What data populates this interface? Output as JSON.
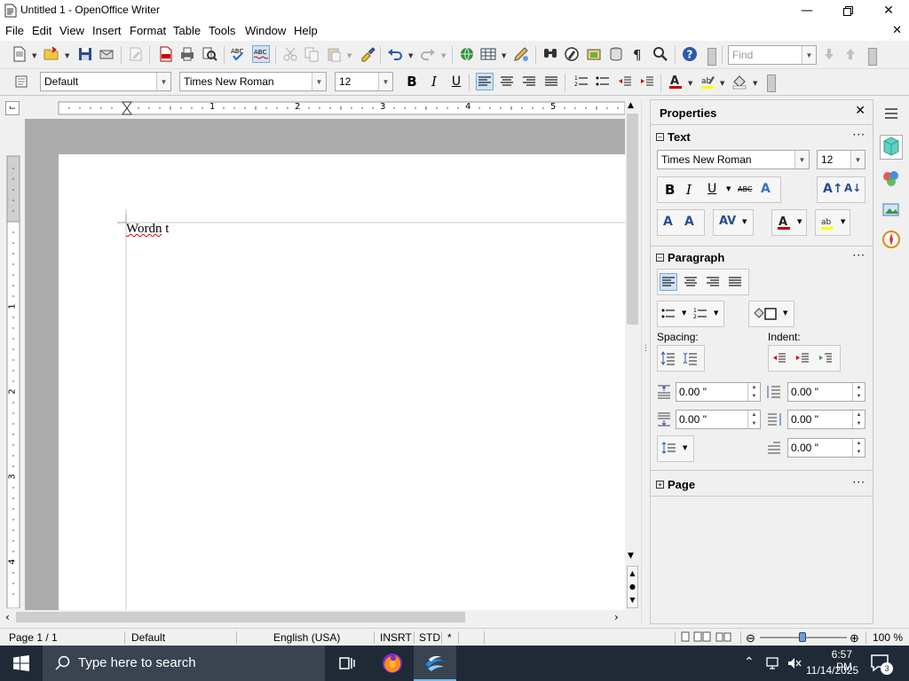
{
  "window": {
    "title": "Untitled 1 - OpenOffice Writer"
  },
  "menu": {
    "items": [
      {
        "label": "File",
        "mnemonic": "F"
      },
      {
        "label": "Edit",
        "mnemonic": "E"
      },
      {
        "label": "View",
        "mnemonic": "V"
      },
      {
        "label": "Insert",
        "mnemonic": "I"
      },
      {
        "label": "Format",
        "mnemonic": "o"
      },
      {
        "label": "Table",
        "mnemonic": "a"
      },
      {
        "label": "Tools",
        "mnemonic": "T"
      },
      {
        "label": "Window",
        "mnemonic": "W"
      },
      {
        "label": "Help",
        "mnemonic": "H"
      }
    ]
  },
  "toolbar": {
    "find_placeholder": "Find"
  },
  "format_toolbar": {
    "paragraph_style": "Default",
    "font_name": "Times New Roman",
    "font_size": "12"
  },
  "ruler": {
    "h_numbers": [
      "1",
      "2",
      "3",
      "4",
      "5"
    ],
    "v_numbers": [
      "1",
      "2",
      "3",
      "4"
    ]
  },
  "document": {
    "text_misspelled": "Wordn",
    "text_rest": " t"
  },
  "sidebar": {
    "title": "Properties",
    "text_section": {
      "header": "Text",
      "font_name": "Times New Roman",
      "font_size": "12"
    },
    "paragraph_section": {
      "header": "Paragraph",
      "spacing_label": "Spacing:",
      "indent_label": "Indent:",
      "above_spacing": "0.00 \"",
      "below_spacing": "0.00 \"",
      "before_indent": "0.00 \"",
      "after_indent": "0.00 \"",
      "first_line_indent": "0.00 \""
    },
    "page_section": {
      "header": "Page"
    }
  },
  "statusbar": {
    "page": "Page 1 / 1",
    "style": "Default",
    "language": "English (USA)",
    "insert_mode": "INSRT",
    "selection_mode": "STD",
    "modified": "*",
    "zoom": "100 %",
    "zoom_level": 1.0
  },
  "taskbar": {
    "search_placeholder": "Type here to search",
    "time": "6:57 PM",
    "date": "11/14/2025",
    "notification_count": "3"
  },
  "colors": {
    "accent": "#0078d7",
    "font_color": "#c00000",
    "highlight": "#ffff00",
    "taskbar": "#1f2a36"
  }
}
